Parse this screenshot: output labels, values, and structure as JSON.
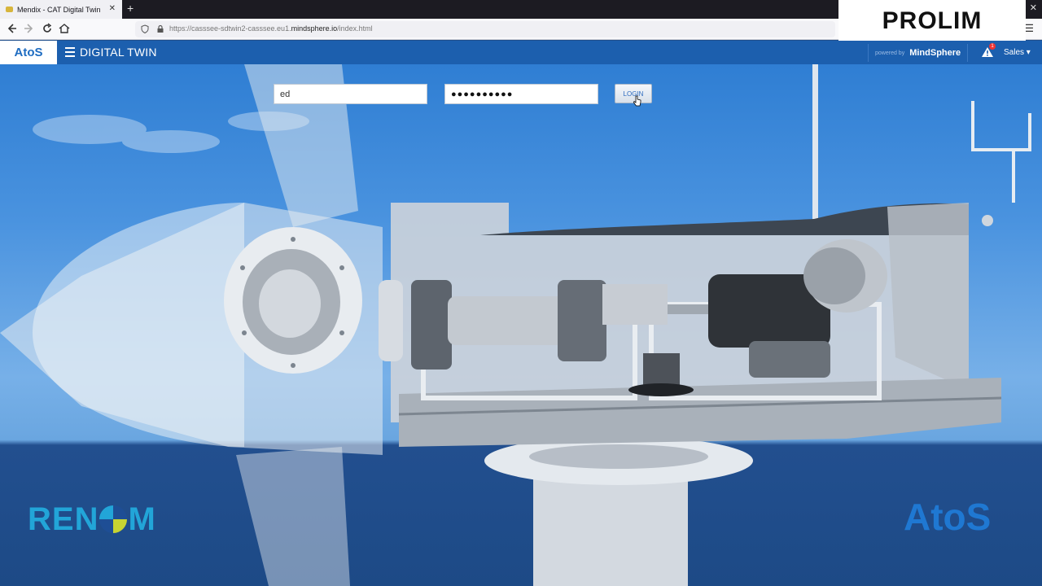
{
  "browser": {
    "tab_title": "Mendix - CAT Digital Twin",
    "tab_close": "✕",
    "new_tab": "+",
    "window_close": "✕",
    "url_prefix": "https://casssee-sdtwin2-casssee.eu1.",
    "url_domain": "mindsphere.io",
    "url_suffix": "/index.html",
    "menu_icon": "☰"
  },
  "overlay": {
    "brand": "PROLIM"
  },
  "header": {
    "logo": "AtoS",
    "title": "DIGITAL TWIN",
    "powered_by": "powered by",
    "mindsphere": "MindSphere",
    "alert_count": "1",
    "user_menu": "Sales ▾"
  },
  "login": {
    "username_value": "ed",
    "password_value": "●●●●●●●●●●",
    "button_label": "LOGIN"
  },
  "footer": {
    "renom_left": "REN",
    "renom_right": "M",
    "atos_logo": "AtoS"
  },
  "colors": {
    "header_blue": "#1c5fae",
    "atos_blue": "#1e6cc1",
    "renom_cyan": "#22a5d8",
    "sky": "#4a93df",
    "ground": "#1d4a86"
  },
  "icons": [
    "back-icon",
    "forward-icon",
    "reload-icon",
    "home-icon",
    "shield-icon",
    "lock-icon",
    "hamburger-icon",
    "alert-icon",
    "cursor-icon"
  ]
}
